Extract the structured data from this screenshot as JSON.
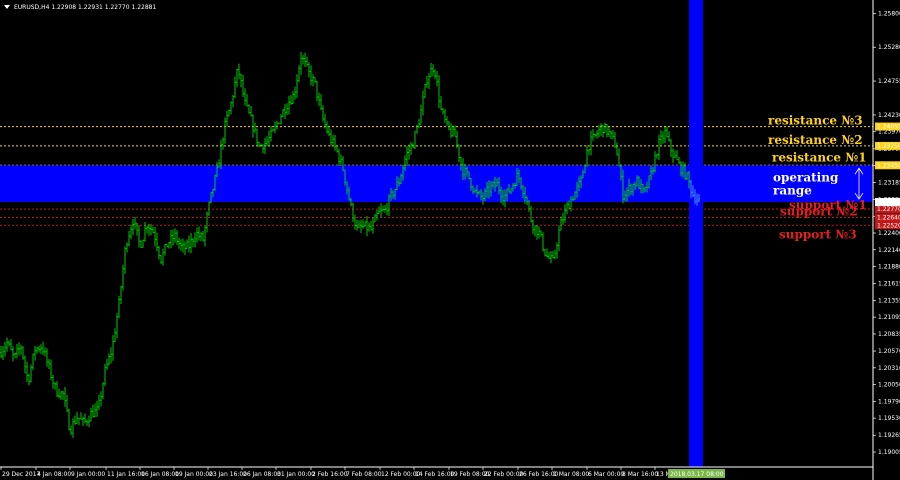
{
  "chart_data": {
    "type": "candlestick",
    "symbol_info": "EURUSD,H4  1.22908 1.22931 1.22770 1.22881",
    "colors": {
      "background": "#000000",
      "bars": "#00e000",
      "zone": "#0000ff",
      "resistance_text": "#ffd21a",
      "resistance_line": "#ffd21a",
      "support_text": "#e02020",
      "support_line": "#c01818",
      "white_text": "#ffffff",
      "axis": "#ffffff"
    },
    "ylim": [
      1.1885,
      1.2595
    ],
    "y_ticks": [
      "1.25800",
      "1.25280",
      "1.24755",
      "1.24230",
      "1.23970",
      "1.23705",
      "1.23445",
      "1.23185",
      "1.22920",
      "1.22660",
      "1.22400",
      "1.22140",
      "1.21880",
      "1.21615",
      "1.21355",
      "1.21095",
      "1.20835",
      "1.20570",
      "1.20310",
      "1.20050",
      "1.19790",
      "1.19530",
      "1.19265",
      "1.19005"
    ],
    "x_ticks": [
      "29 Dec 2017",
      "4 Jan 08:00",
      "9 Jan 00:00",
      "11 Jan 16:00",
      "16 Jan 08:00",
      "19 Jan 00:00",
      "23 Jan 16:00",
      "26 Jan 08:00",
      "31 Jan 00:00",
      "2 Feb 16:00",
      "7 Feb 08:00",
      "12 Feb 00:00",
      "14 Feb 16:00",
      "19 Feb 08:00",
      "22 Feb 00:00",
      "26 Feb 16:00",
      "1 Mar 08:00",
      "6 Mar 00:00",
      "8 Mar 16:00",
      "13 Mar"
    ],
    "x_highlight": "2018.03.17 08:00",
    "levels": [
      {
        "name": "resistance №3",
        "price": 1.2405,
        "tag": "1.24050",
        "kind": "resistance"
      },
      {
        "name": "resistance №2",
        "price": 1.2375,
        "tag": "1.23750",
        "kind": "resistance"
      },
      {
        "name": "resistance №1",
        "price": 1.2345,
        "tag": "1.23450",
        "kind": "resistance"
      },
      {
        "name": "support №1",
        "price": 1.2277,
        "tag": "1.22770",
        "kind": "support"
      },
      {
        "name": "support №2",
        "price": 1.2264,
        "tag": "1.22640",
        "kind": "support"
      },
      {
        "name": "support №3",
        "price": 1.2252,
        "tag": "1.22520",
        "kind": "support"
      }
    ],
    "zone": {
      "top": 1.2345,
      "bottom": 1.2288,
      "label_line1": "operating",
      "label_line2": "range",
      "top_tag": "1.23450",
      "bottom_tag": "1.22881"
    },
    "current_price_tag": "1.22881",
    "close_path": [
      [
        0,
        1.2055
      ],
      [
        7,
        1.207
      ],
      [
        14,
        1.2045
      ],
      [
        21,
        1.2065
      ],
      [
        28,
        1.201
      ],
      [
        35,
        1.206
      ],
      [
        42,
        1.2065
      ],
      [
        49,
        1.203
      ],
      [
        56,
        1.1995
      ],
      [
        63,
        1.199
      ],
      [
        70,
        1.1935
      ],
      [
        77,
        1.1955
      ],
      [
        84,
        1.1945
      ],
      [
        91,
        1.196
      ],
      [
        98,
        1.1965
      ],
      [
        105,
        1.2025
      ],
      [
        112,
        1.206
      ],
      [
        119,
        1.213
      ],
      [
        126,
        1.2225
      ],
      [
        133,
        1.226
      ],
      [
        140,
        1.222
      ],
      [
        147,
        1.2255
      ],
      [
        154,
        1.224
      ],
      [
        161,
        1.22
      ],
      [
        168,
        1.2225
      ],
      [
        175,
        1.2235
      ],
      [
        182,
        1.2215
      ],
      [
        189,
        1.222
      ],
      [
        196,
        1.224
      ],
      [
        203,
        1.223
      ],
      [
        210,
        1.229
      ],
      [
        217,
        1.2335
      ],
      [
        224,
        1.24
      ],
      [
        231,
        1.244
      ],
      [
        238,
        1.2495
      ],
      [
        245,
        1.244
      ],
      [
        252,
        1.241
      ],
      [
        259,
        1.2375
      ],
      [
        266,
        1.238
      ],
      [
        273,
        1.2395
      ],
      [
        280,
        1.242
      ],
      [
        287,
        1.244
      ],
      [
        294,
        1.2455
      ],
      [
        301,
        1.2515
      ],
      [
        308,
        1.249
      ],
      [
        315,
        1.247
      ],
      [
        322,
        1.242
      ],
      [
        329,
        1.239
      ],
      [
        336,
        1.237
      ],
      [
        343,
        1.234
      ],
      [
        350,
        1.2285
      ],
      [
        357,
        1.2245
      ],
      [
        364,
        1.225
      ],
      [
        371,
        1.2245
      ],
      [
        378,
        1.227
      ],
      [
        385,
        1.2275
      ],
      [
        392,
        1.23
      ],
      [
        399,
        1.232
      ],
      [
        406,
        1.236
      ],
      [
        413,
        1.238
      ],
      [
        420,
        1.242
      ],
      [
        427,
        1.248
      ],
      [
        434,
        1.25
      ],
      [
        441,
        1.243
      ],
      [
        448,
        1.24
      ],
      [
        455,
        1.239
      ],
      [
        462,
        1.234
      ],
      [
        469,
        1.2325
      ],
      [
        476,
        1.23
      ],
      [
        483,
        1.2295
      ],
      [
        490,
        1.231
      ],
      [
        497,
        1.2315
      ],
      [
        504,
        1.2295
      ],
      [
        511,
        1.231
      ],
      [
        518,
        1.233
      ],
      [
        525,
        1.23
      ],
      [
        532,
        1.2255
      ],
      [
        539,
        1.224
      ],
      [
        546,
        1.2205
      ],
      [
        553,
        1.2195
      ],
      [
        560,
        1.225
      ],
      [
        567,
        1.228
      ],
      [
        574,
        1.23
      ],
      [
        581,
        1.232
      ],
      [
        588,
        1.2375
      ],
      [
        595,
        1.239
      ],
      [
        602,
        1.2405
      ],
      [
        609,
        1.2395
      ],
      [
        616,
        1.2375
      ],
      [
        623,
        1.23
      ],
      [
        630,
        1.231
      ],
      [
        637,
        1.232
      ],
      [
        644,
        1.23
      ],
      [
        651,
        1.233
      ],
      [
        658,
        1.2375
      ],
      [
        665,
        1.2395
      ],
      [
        672,
        1.2365
      ],
      [
        679,
        1.2345
      ],
      [
        686,
        1.233
      ],
      [
        693,
        1.23
      ],
      [
        700,
        1.2288
      ]
    ]
  }
}
